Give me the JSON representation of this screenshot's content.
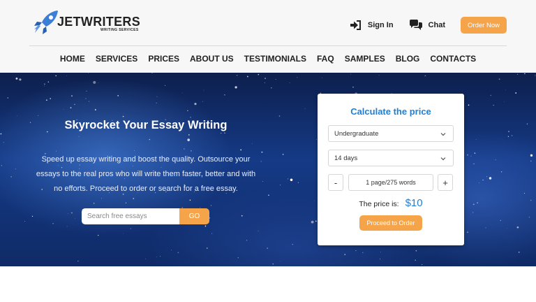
{
  "brand": {
    "name": "JETWRITERS",
    "tagline": "WRITING SERVICES",
    "icon": "rocket-icon",
    "colors": {
      "accent": "#f5a44a",
      "primary_blue": "#1f7fd6",
      "rocket_blue": "#3b7fd8"
    }
  },
  "header_actions": {
    "signin": {
      "label": "Sign In",
      "icon": "sign-in-icon"
    },
    "chat": {
      "label": "Chat",
      "icon": "chat-icon"
    },
    "order_now": "Order Now"
  },
  "nav": {
    "items": [
      "HOME",
      "SERVICES",
      "PRICES",
      "ABOUT US",
      "TESTIMONIALS",
      "FAQ",
      "SAMPLES",
      "BLOG",
      "CONTACTS"
    ]
  },
  "hero": {
    "title": "Skyrocket Your Essay Writing",
    "lines": [
      "Speed up essay writing and boost the quality. Outsource your",
      "essays to the real pros who will write them faster, better and with",
      "no efforts. Proceed to order or search for a free essay."
    ],
    "search": {
      "placeholder": "Search free essays",
      "button": "GO"
    }
  },
  "calculator": {
    "title": "Calculate the price",
    "level": {
      "value": "Undergraduate",
      "icon": "chevron-down-icon"
    },
    "deadline": {
      "value": "14 days",
      "icon": "chevron-down-icon"
    },
    "minus": "-",
    "plus": "+",
    "pages": "1 page/275 words",
    "price_label": "The price is:",
    "price_value": "$10",
    "proceed": "Proceed to Order"
  }
}
